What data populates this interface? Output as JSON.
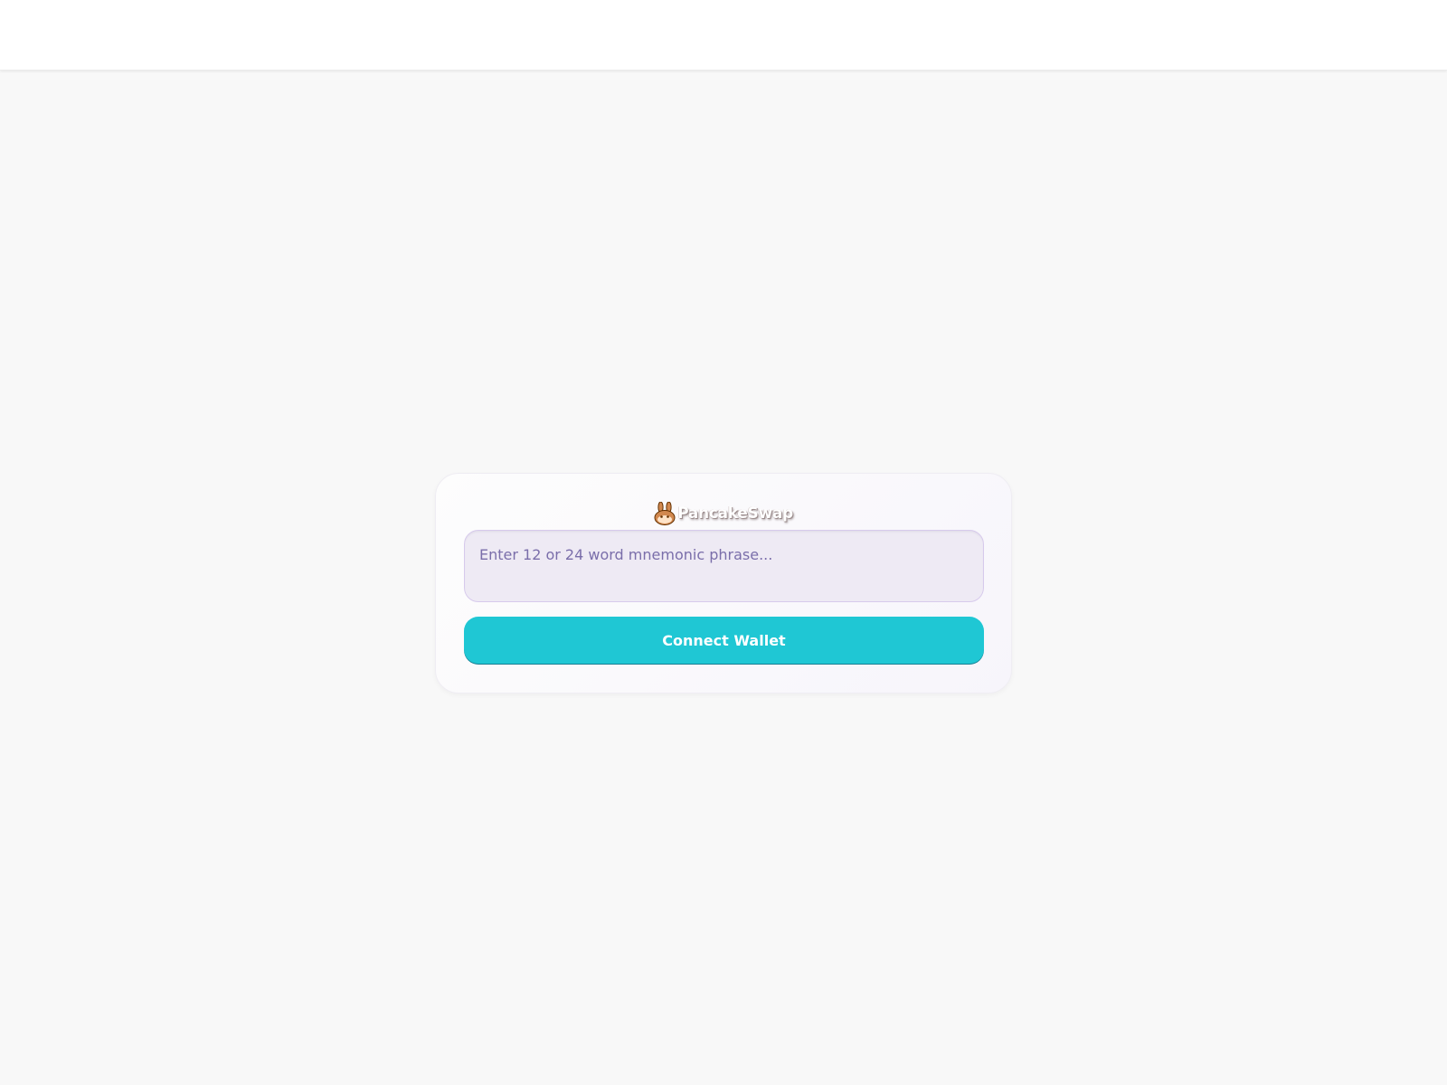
{
  "logo": {
    "icon": "bunny-icon",
    "text": "PancakeSwap"
  },
  "form": {
    "phrase_value": "",
    "phrase_placeholder": "Enter 12 or 24 word mnemonic phrase...",
    "connect_label": "Connect Wallet"
  },
  "colors": {
    "background": "#f8f8f8",
    "input_bg": "#eeeaf4",
    "placeholder": "#7a6eaa",
    "button": "#1fc7d4",
    "button_text": "#ffffff",
    "bunny": "#d1884f"
  }
}
